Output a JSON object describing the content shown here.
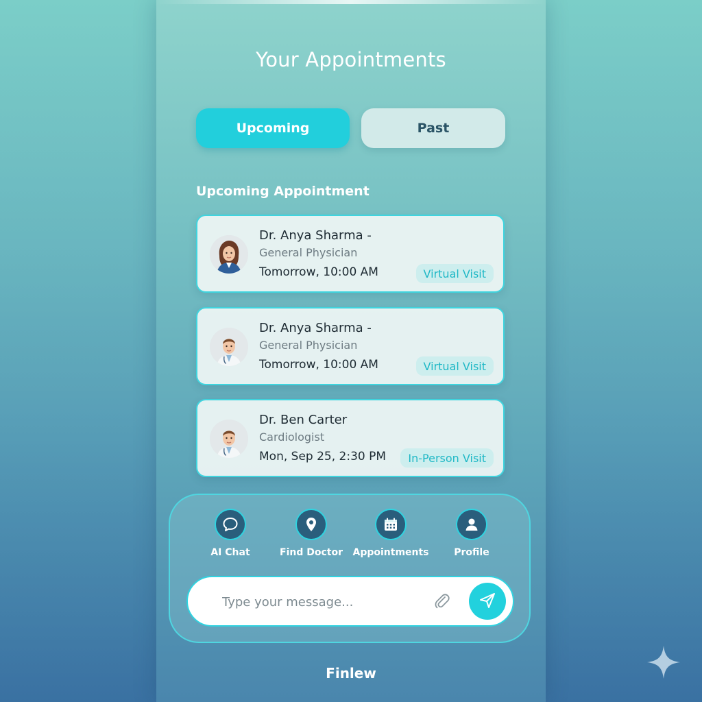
{
  "header": {
    "title": "Your Appointments"
  },
  "tabs": [
    {
      "label": "Upcoming",
      "active": true
    },
    {
      "label": "Past",
      "active": false
    }
  ],
  "section": {
    "heading": "Upcoming Appointment"
  },
  "appointments": [
    {
      "name": "Dr. Anya Sharma -",
      "specialty": "General Physician",
      "time": "Tomorrow, 10:00 AM",
      "visit_type": "Virtual Visit",
      "avatar": "female-doctor-avatar"
    },
    {
      "name": "Dr. Anya Sharma -",
      "specialty": "General Physician",
      "time": "Tomorrow, 10:00 AM",
      "visit_type": "Virtual Visit",
      "avatar": "male-doctor-avatar"
    },
    {
      "name": "Dr. Ben Carter",
      "specialty": "Cardiologist",
      "time": "Mon, Sep 25, 2:30 PM",
      "visit_type": "In-Person Visit",
      "avatar": "male-doctor-avatar"
    }
  ],
  "nav": {
    "items": [
      {
        "label": "AI Chat",
        "icon": "chat-bubble-icon"
      },
      {
        "label": "Find Doctor",
        "icon": "location-pin-icon"
      },
      {
        "label": "Appointments",
        "icon": "calendar-icon"
      },
      {
        "label": "Profile",
        "icon": "user-icon"
      }
    ]
  },
  "message": {
    "placeholder": "Type your message...",
    "attach_icon": "paperclip-icon",
    "send_icon": "send-icon"
  },
  "footer": {
    "brand": "Finlew"
  },
  "colors": {
    "accent": "#22cfdc",
    "card_border": "#3fd4de",
    "nav_circle": "#2a5e7c",
    "badge_text": "#1fb8c6"
  }
}
